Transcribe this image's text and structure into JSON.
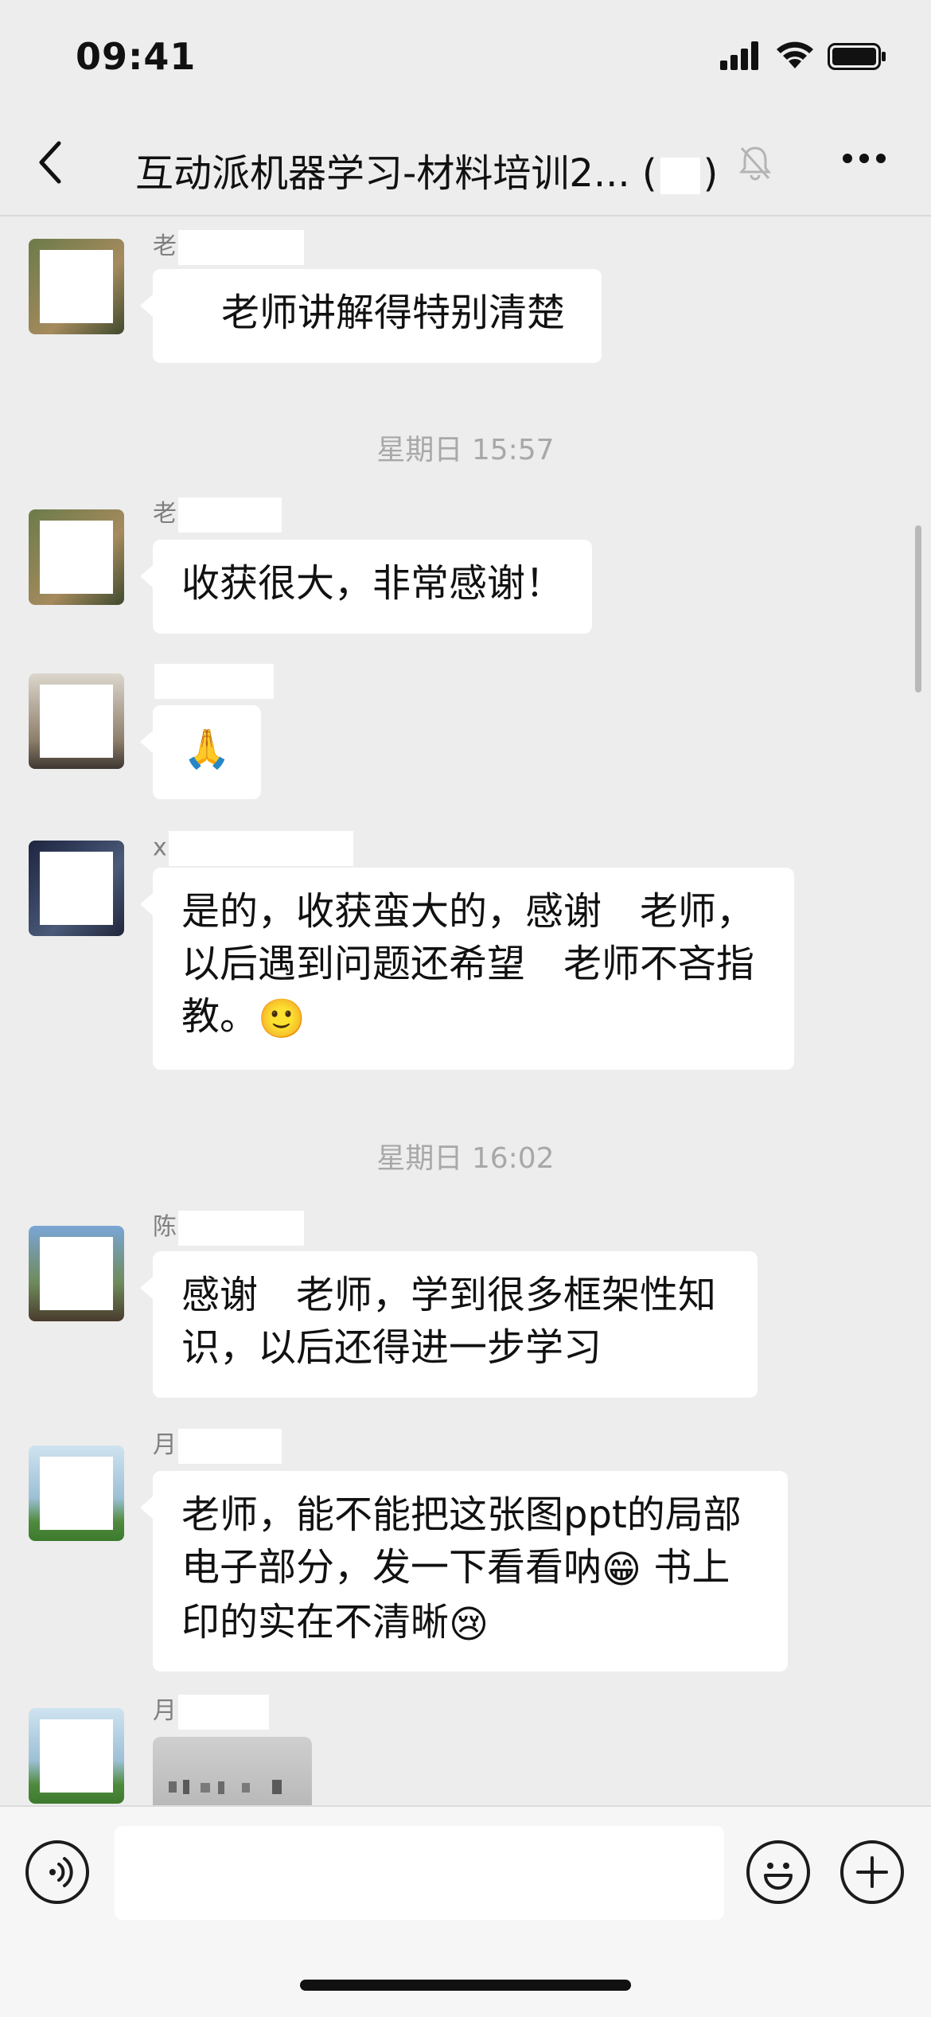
{
  "status_bar": {
    "time": "09:41"
  },
  "header": {
    "title_prefix": "互动派机器学习-材料培训2...",
    "title_paren_open": "(",
    "title_paren_close": ")",
    "icons": [
      "back-icon",
      "muted-bell-icon",
      "more-icon"
    ]
  },
  "messages": [
    {
      "type": "text",
      "sender": "老",
      "text": "老师讲解得特别清楚"
    },
    {
      "type": "timestamp",
      "text": "星期日 15:57"
    },
    {
      "type": "text",
      "sender": "老",
      "text": "收获很大，非常感谢！"
    },
    {
      "type": "emoji",
      "sender": "",
      "emoji": "🙏"
    },
    {
      "type": "text",
      "sender": "x",
      "lines": [
        "是的，收获蛮大的，感谢　老师，",
        "以后遇到问题还希望　老师不吝指",
        "教。"
      ],
      "trailing_emoji": "🙂"
    },
    {
      "type": "timestamp",
      "text": "星期日 16:02"
    },
    {
      "type": "text",
      "sender": "陈",
      "lines": [
        "感谢　老师，学到很多框架性知",
        "识，以后还得进一步学习"
      ]
    },
    {
      "type": "text",
      "sender": "月",
      "lines": [
        "老师，能不能把这张图ppt的局部",
        "电子部分，发一下看看呐",
        "书上",
        "印的实在不清晰"
      ],
      "emojis": [
        "😁",
        "😢"
      ]
    },
    {
      "type": "image",
      "sender": "月"
    }
  ],
  "input_bar": {
    "placeholder": "",
    "icons": [
      "voice-icon",
      "emoji-face-icon",
      "plus-icon"
    ]
  }
}
